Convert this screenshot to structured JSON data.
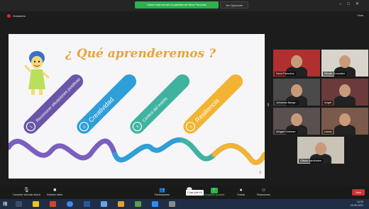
{
  "window": {
    "share_banner": "Usted está viendo la pantalla de Nicol Parvulos",
    "view_options": "Ver Opciones",
    "recording": "Grabando",
    "view_label": "Vista"
  },
  "slide": {
    "title": "¿ Qué aprenderemos ?",
    "items": [
      {
        "label": "Reconocer situaciones positivas",
        "color": "#6a55a8"
      },
      {
        "label": "Creatividad",
        "color": "#2f9fd8"
      },
      {
        "label": "Control del estrés",
        "color": "#3fb3a0"
      },
      {
        "label": "Resiliencia",
        "color": "#f2b432"
      }
    ],
    "page_number": "2"
  },
  "participants": [
    {
      "name": "Nicol Parvulos",
      "bg": "#b03030"
    },
    {
      "name": "Nicole Gonzalez",
      "bg": "#d8d4cc"
    },
    {
      "name": "Johanna Barga...",
      "bg": "#4a4a4a"
    },
    {
      "name": "Angel",
      "bg": "#6b3a3a"
    },
    {
      "name": "Abigail Soliman",
      "bg": "#5a5050"
    },
    {
      "name": "Laura",
      "bg": "#7a5a4a"
    },
    {
      "name": "Ulises cambiales",
      "bg": "#c9c3b8"
    }
  ],
  "toolbar": {
    "mute": "Cancelar silenciar ahora",
    "video": "Detener video",
    "participants": "Participantes",
    "participants_count": "9",
    "chat": "Chat",
    "share": "Compartir pantalla",
    "record": "Grabar",
    "reactions": "Reacciones",
    "end": "Salir",
    "tooltip": "Chat (Alt+H)"
  },
  "taskbar": {
    "time": "14:09",
    "date": "16-09-2021"
  }
}
